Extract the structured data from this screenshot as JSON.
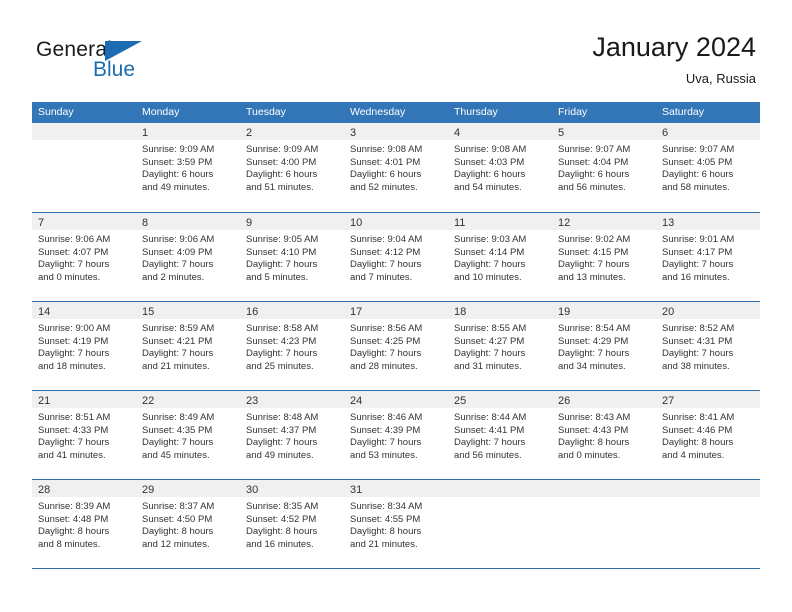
{
  "brand": {
    "name_part1": "General",
    "name_part2": "Blue",
    "triangle_color": "#1b6cb0"
  },
  "header": {
    "title": "January 2024",
    "subtitle": "Uva, Russia"
  },
  "theme": {
    "header_blue": "#3376b8",
    "rule_blue": "#2f6fab",
    "day_strip_gray": "#f0f0f0",
    "text": "#333333"
  },
  "weekdays": [
    "Sunday",
    "Monday",
    "Tuesday",
    "Wednesday",
    "Thursday",
    "Friday",
    "Saturday"
  ],
  "weeks": [
    [
      {
        "day": "",
        "lines": []
      },
      {
        "day": "1",
        "lines": [
          "Sunrise: 9:09 AM",
          "Sunset: 3:59 PM",
          "Daylight: 6 hours",
          "and 49 minutes."
        ]
      },
      {
        "day": "2",
        "lines": [
          "Sunrise: 9:09 AM",
          "Sunset: 4:00 PM",
          "Daylight: 6 hours",
          "and 51 minutes."
        ]
      },
      {
        "day": "3",
        "lines": [
          "Sunrise: 9:08 AM",
          "Sunset: 4:01 PM",
          "Daylight: 6 hours",
          "and 52 minutes."
        ]
      },
      {
        "day": "4",
        "lines": [
          "Sunrise: 9:08 AM",
          "Sunset: 4:03 PM",
          "Daylight: 6 hours",
          "and 54 minutes."
        ]
      },
      {
        "day": "5",
        "lines": [
          "Sunrise: 9:07 AM",
          "Sunset: 4:04 PM",
          "Daylight: 6 hours",
          "and 56 minutes."
        ]
      },
      {
        "day": "6",
        "lines": [
          "Sunrise: 9:07 AM",
          "Sunset: 4:05 PM",
          "Daylight: 6 hours",
          "and 58 minutes."
        ]
      }
    ],
    [
      {
        "day": "7",
        "lines": [
          "Sunrise: 9:06 AM",
          "Sunset: 4:07 PM",
          "Daylight: 7 hours",
          "and 0 minutes."
        ]
      },
      {
        "day": "8",
        "lines": [
          "Sunrise: 9:06 AM",
          "Sunset: 4:09 PM",
          "Daylight: 7 hours",
          "and 2 minutes."
        ]
      },
      {
        "day": "9",
        "lines": [
          "Sunrise: 9:05 AM",
          "Sunset: 4:10 PM",
          "Daylight: 7 hours",
          "and 5 minutes."
        ]
      },
      {
        "day": "10",
        "lines": [
          "Sunrise: 9:04 AM",
          "Sunset: 4:12 PM",
          "Daylight: 7 hours",
          "and 7 minutes."
        ]
      },
      {
        "day": "11",
        "lines": [
          "Sunrise: 9:03 AM",
          "Sunset: 4:14 PM",
          "Daylight: 7 hours",
          "and 10 minutes."
        ]
      },
      {
        "day": "12",
        "lines": [
          "Sunrise: 9:02 AM",
          "Sunset: 4:15 PM",
          "Daylight: 7 hours",
          "and 13 minutes."
        ]
      },
      {
        "day": "13",
        "lines": [
          "Sunrise: 9:01 AM",
          "Sunset: 4:17 PM",
          "Daylight: 7 hours",
          "and 16 minutes."
        ]
      }
    ],
    [
      {
        "day": "14",
        "lines": [
          "Sunrise: 9:00 AM",
          "Sunset: 4:19 PM",
          "Daylight: 7 hours",
          "and 18 minutes."
        ]
      },
      {
        "day": "15",
        "lines": [
          "Sunrise: 8:59 AM",
          "Sunset: 4:21 PM",
          "Daylight: 7 hours",
          "and 21 minutes."
        ]
      },
      {
        "day": "16",
        "lines": [
          "Sunrise: 8:58 AM",
          "Sunset: 4:23 PM",
          "Daylight: 7 hours",
          "and 25 minutes."
        ]
      },
      {
        "day": "17",
        "lines": [
          "Sunrise: 8:56 AM",
          "Sunset: 4:25 PM",
          "Daylight: 7 hours",
          "and 28 minutes."
        ]
      },
      {
        "day": "18",
        "lines": [
          "Sunrise: 8:55 AM",
          "Sunset: 4:27 PM",
          "Daylight: 7 hours",
          "and 31 minutes."
        ]
      },
      {
        "day": "19",
        "lines": [
          "Sunrise: 8:54 AM",
          "Sunset: 4:29 PM",
          "Daylight: 7 hours",
          "and 34 minutes."
        ]
      },
      {
        "day": "20",
        "lines": [
          "Sunrise: 8:52 AM",
          "Sunset: 4:31 PM",
          "Daylight: 7 hours",
          "and 38 minutes."
        ]
      }
    ],
    [
      {
        "day": "21",
        "lines": [
          "Sunrise: 8:51 AM",
          "Sunset: 4:33 PM",
          "Daylight: 7 hours",
          "and 41 minutes."
        ]
      },
      {
        "day": "22",
        "lines": [
          "Sunrise: 8:49 AM",
          "Sunset: 4:35 PM",
          "Daylight: 7 hours",
          "and 45 minutes."
        ]
      },
      {
        "day": "23",
        "lines": [
          "Sunrise: 8:48 AM",
          "Sunset: 4:37 PM",
          "Daylight: 7 hours",
          "and 49 minutes."
        ]
      },
      {
        "day": "24",
        "lines": [
          "Sunrise: 8:46 AM",
          "Sunset: 4:39 PM",
          "Daylight: 7 hours",
          "and 53 minutes."
        ]
      },
      {
        "day": "25",
        "lines": [
          "Sunrise: 8:44 AM",
          "Sunset: 4:41 PM",
          "Daylight: 7 hours",
          "and 56 minutes."
        ]
      },
      {
        "day": "26",
        "lines": [
          "Sunrise: 8:43 AM",
          "Sunset: 4:43 PM",
          "Daylight: 8 hours",
          "and 0 minutes."
        ]
      },
      {
        "day": "27",
        "lines": [
          "Sunrise: 8:41 AM",
          "Sunset: 4:46 PM",
          "Daylight: 8 hours",
          "and 4 minutes."
        ]
      }
    ],
    [
      {
        "day": "28",
        "lines": [
          "Sunrise: 8:39 AM",
          "Sunset: 4:48 PM",
          "Daylight: 8 hours",
          "and 8 minutes."
        ]
      },
      {
        "day": "29",
        "lines": [
          "Sunrise: 8:37 AM",
          "Sunset: 4:50 PM",
          "Daylight: 8 hours",
          "and 12 minutes."
        ]
      },
      {
        "day": "30",
        "lines": [
          "Sunrise: 8:35 AM",
          "Sunset: 4:52 PM",
          "Daylight: 8 hours",
          "and 16 minutes."
        ]
      },
      {
        "day": "31",
        "lines": [
          "Sunrise: 8:34 AM",
          "Sunset: 4:55 PM",
          "Daylight: 8 hours",
          "and 21 minutes."
        ]
      },
      {
        "day": "",
        "lines": []
      },
      {
        "day": "",
        "lines": []
      },
      {
        "day": "",
        "lines": []
      }
    ]
  ]
}
